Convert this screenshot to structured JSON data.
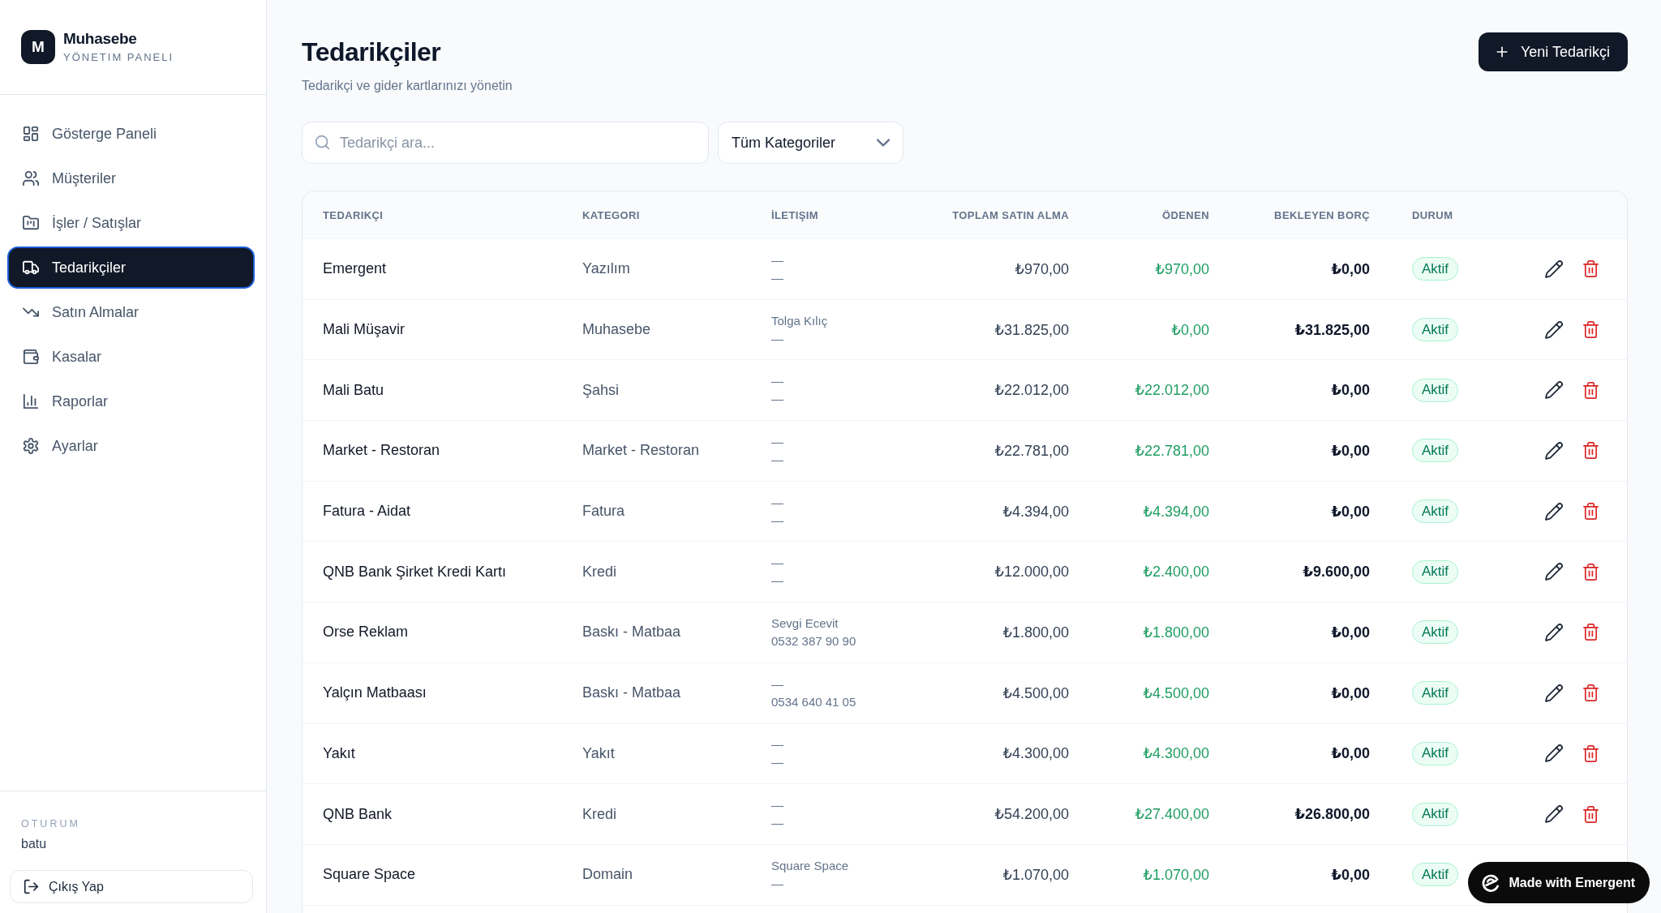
{
  "sidebar": {
    "logo": {
      "letter": "M",
      "title": "Muhasebe",
      "subtitle": "YÖNETIM PANELI"
    },
    "nav": [
      {
        "label": "Gösterge Paneli",
        "selected": false
      },
      {
        "label": "Müşteriler",
        "selected": false
      },
      {
        "label": "İşler / Satışlar",
        "selected": false
      },
      {
        "label": "Tedarikçiler",
        "selected": true
      },
      {
        "label": "Satın Almalar",
        "selected": false
      },
      {
        "label": "Kasalar",
        "selected": false
      },
      {
        "label": "Raporlar",
        "selected": false
      },
      {
        "label": "Ayarlar",
        "selected": false
      }
    ],
    "session": {
      "label": "OTURUM",
      "user": "batu"
    },
    "logout_button": "Çıkış Yap"
  },
  "header": {
    "title": "Tedarikçiler",
    "subtitle": "Tedarikçi ve gider kartlarınızı yönetin",
    "new_button": "Yeni Tedarikçi"
  },
  "filters": {
    "search": {
      "placeholder": "Tedarikçi ara..."
    },
    "category": {
      "value": "Tüm Kategoriler"
    }
  },
  "table": {
    "columns": [
      "TEDARIKÇI",
      "KATEGORI",
      "İLETIŞIM",
      "TOPLAM SATIN ALMA",
      "ÖDENEN",
      "BEKLEYEN BORÇ",
      "DURUM"
    ],
    "rows": [
      {
        "supplier": "Emergent",
        "category": "Yazılım",
        "contact": {
          "name": "—",
          "phone": "—"
        },
        "total": "₺970,00",
        "paid": "₺970,00",
        "pending": "₺0,00",
        "status": "Aktif",
        "actions": [
          {
            "kind": "edit"
          },
          {
            "kind": "delete"
          }
        ]
      },
      {
        "supplier": "Mali Müşavir",
        "category": "Muhasebe",
        "contact": {
          "name": "Tolga Kılıç",
          "phone": "—"
        },
        "total": "₺31.825,00",
        "paid": "₺0,00",
        "pending": "₺31.825,00",
        "status": "Aktif",
        "actions": [
          {
            "kind": "edit"
          },
          {
            "kind": "delete"
          }
        ]
      },
      {
        "supplier": "Mali Batu",
        "category": "Şahsi",
        "contact": {
          "name": "—",
          "phone": "—"
        },
        "total": "₺22.012,00",
        "paid": "₺22.012,00",
        "pending": "₺0,00",
        "status": "Aktif",
        "actions": [
          {
            "kind": "edit"
          },
          {
            "kind": "delete"
          }
        ]
      },
      {
        "supplier": "Market - Restoran",
        "category": "Market - Restoran",
        "contact": {
          "name": "—",
          "phone": "—"
        },
        "total": "₺22.781,00",
        "paid": "₺22.781,00",
        "pending": "₺0,00",
        "status": "Aktif",
        "actions": [
          {
            "kind": "edit"
          },
          {
            "kind": "delete"
          }
        ]
      },
      {
        "supplier": "Fatura - Aidat",
        "category": "Fatura",
        "contact": {
          "name": "—",
          "phone": "—"
        },
        "total": "₺4.394,00",
        "paid": "₺4.394,00",
        "pending": "₺0,00",
        "status": "Aktif",
        "actions": [
          {
            "kind": "edit"
          },
          {
            "kind": "delete"
          }
        ]
      },
      {
        "supplier": "QNB Bank Şirket Kredi Kartı",
        "category": "Kredi",
        "contact": {
          "name": "—",
          "phone": "—"
        },
        "total": "₺12.000,00",
        "paid": "₺2.400,00",
        "pending": "₺9.600,00",
        "status": "Aktif",
        "actions": [
          {
            "kind": "edit"
          },
          {
            "kind": "delete"
          }
        ]
      },
      {
        "supplier": "Orse Reklam",
        "category": "Baskı - Matbaa",
        "contact": {
          "name": "Sevgi Ecevit",
          "phone": "0532 387 90 90"
        },
        "total": "₺1.800,00",
        "paid": "₺1.800,00",
        "pending": "₺0,00",
        "status": "Aktif",
        "actions": [
          {
            "kind": "edit"
          },
          {
            "kind": "delete"
          }
        ]
      },
      {
        "supplier": "Yalçın Matbaası",
        "category": "Baskı - Matbaa",
        "contact": {
          "name": "—",
          "phone": "0534 640 41 05"
        },
        "total": "₺4.500,00",
        "paid": "₺4.500,00",
        "pending": "₺0,00",
        "status": "Aktif",
        "actions": [
          {
            "kind": "edit"
          },
          {
            "kind": "delete"
          }
        ]
      },
      {
        "supplier": "Yakıt",
        "category": "Yakıt",
        "contact": {
          "name": "—",
          "phone": "—"
        },
        "total": "₺4.300,00",
        "paid": "₺4.300,00",
        "pending": "₺0,00",
        "status": "Aktif",
        "actions": [
          {
            "kind": "edit"
          },
          {
            "kind": "delete"
          }
        ]
      },
      {
        "supplier": "QNB Bank",
        "category": "Kredi",
        "contact": {
          "name": "—",
          "phone": "—"
        },
        "total": "₺54.200,00",
        "paid": "₺27.400,00",
        "pending": "₺26.800,00",
        "status": "Aktif",
        "actions": [
          {
            "kind": "edit"
          },
          {
            "kind": "delete"
          }
        ]
      },
      {
        "supplier": "Square Space",
        "category": "Domain",
        "contact": {
          "name": "Square Space",
          "phone": "—"
        },
        "total": "₺1.070,00",
        "paid": "₺1.070,00",
        "pending": "₺0,00",
        "status": "Aktif"
      }
    ]
  },
  "badge": {
    "text": "Made with Emergent"
  }
}
